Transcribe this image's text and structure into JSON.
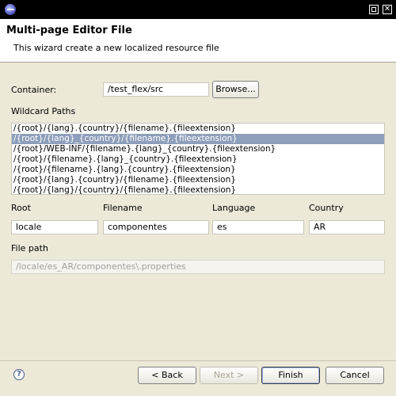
{
  "window": {
    "icon": "eclipse-icon",
    "controls": [
      "maximize-icon",
      "close-icon"
    ],
    "close_glyph": "✕"
  },
  "header": {
    "title": "Multi-page Editor File",
    "description": "This wizard create a new localized resource file"
  },
  "container": {
    "label": "Container:",
    "value": "/test_flex/src",
    "browse_label": "Browse..."
  },
  "wildcard": {
    "label": "Wildcard Paths",
    "items": [
      "/{root}/{lang}.{country}/{filename}.{fileextension}",
      "/{root}/{lang}_{country}/{filename}.{fileextension}",
      "/{root}/WEB-INF/{filename}.{lang}_{country}.{fileextension}",
      "/{root}/{filename}.{lang}_{country}.{fileextension}",
      "/{root}/{filename}.{lang}.{country}.{fileextension}",
      "/{root}/{lang}.{country}/{filename}.{fileextension}",
      "/{root}/{lang}/{country}/{filename}.{fileextension}"
    ],
    "selected_index": 1
  },
  "fields": {
    "root_label": "Root",
    "root_value": "locale",
    "filename_label": "Filename",
    "filename_value": "componentes",
    "language_label": "Language",
    "language_value": "es",
    "country_label": "Country",
    "country_value": "AR"
  },
  "file_path": {
    "label": "File path",
    "value": "/locale/es_AR/componentes\\.properties"
  },
  "buttons": {
    "help_glyph": "?",
    "back_label": "< Back",
    "next_label": "Next >",
    "finish_label": "Finish",
    "cancel_label": "Cancel"
  }
}
